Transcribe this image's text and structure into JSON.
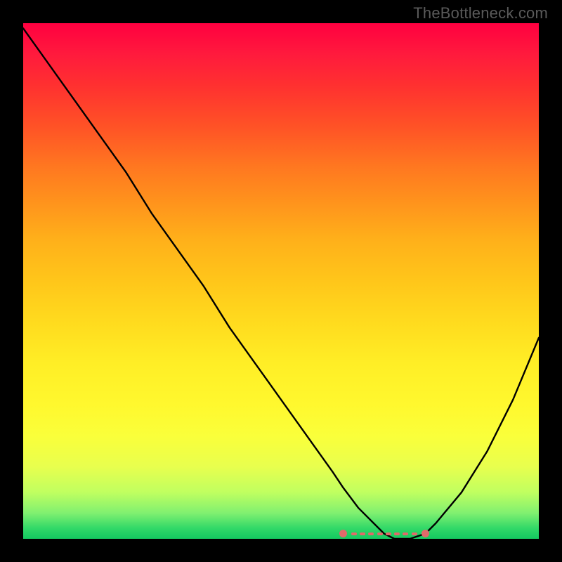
{
  "watermark": "TheBottleneck.com",
  "colors": {
    "frame": "#000000",
    "curve": "#000000",
    "fit_marker": "#e06a6a"
  },
  "chart_data": {
    "type": "line",
    "title": "",
    "xlabel": "",
    "ylabel": "",
    "xlim": [
      0,
      100
    ],
    "ylim": [
      0,
      100
    ],
    "grid": false,
    "legend": false,
    "x": [
      0,
      5,
      10,
      15,
      20,
      25,
      30,
      35,
      40,
      45,
      50,
      55,
      60,
      62,
      65,
      68,
      70,
      72,
      75,
      78,
      80,
      85,
      90,
      95,
      100
    ],
    "values": [
      99,
      92,
      85,
      78,
      71,
      63,
      56,
      49,
      41,
      34,
      27,
      20,
      13,
      10,
      6,
      3,
      1,
      0,
      0,
      1,
      3,
      9,
      17,
      27,
      39
    ],
    "fit_range": {
      "start_x": 62,
      "end_x": 78,
      "y": 1
    }
  }
}
